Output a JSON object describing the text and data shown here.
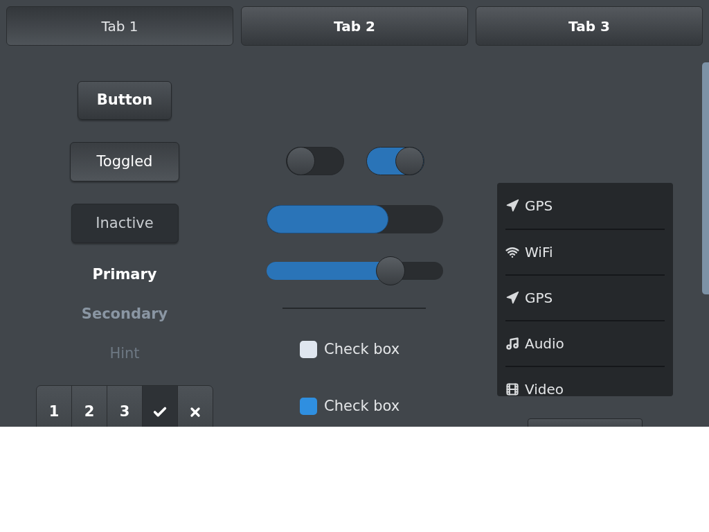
{
  "tabs": [
    {
      "label": "Tab 1",
      "selected": true
    },
    {
      "label": "Tab 2",
      "selected": false
    },
    {
      "label": "Tab 3",
      "selected": false
    }
  ],
  "buttons": [
    {
      "label": "Button",
      "kind": "normal"
    },
    {
      "label": "Toggled",
      "kind": "toggled"
    },
    {
      "label": "Inactive",
      "kind": "inactive"
    }
  ],
  "labels": [
    {
      "text": "Primary",
      "kind": "primary"
    },
    {
      "text": "Secondary",
      "kind": "secondary"
    },
    {
      "text": "Hint",
      "kind": "hint"
    }
  ],
  "segments": [
    {
      "kind": "text",
      "label": "1",
      "selected": false
    },
    {
      "kind": "text",
      "label": "2",
      "selected": false
    },
    {
      "kind": "text",
      "label": "3",
      "selected": false
    },
    {
      "kind": "check",
      "selected": true
    },
    {
      "kind": "close",
      "selected": false
    }
  ],
  "switches": [
    {
      "on": false
    },
    {
      "on": true
    }
  ],
  "progress": {
    "level": 0.69
  },
  "slider": {
    "level": 0.7
  },
  "checkboxes": [
    {
      "label": "Check box",
      "checked": false
    },
    {
      "label": "Check box",
      "checked": true
    }
  ],
  "list": [
    {
      "kind": "gps",
      "label": "GPS"
    },
    {
      "kind": "wifi",
      "label": "WiFi"
    },
    {
      "kind": "gps",
      "label": "GPS"
    },
    {
      "kind": "audio",
      "label": "Audio"
    },
    {
      "kind": "video",
      "label": "Video"
    }
  ]
}
